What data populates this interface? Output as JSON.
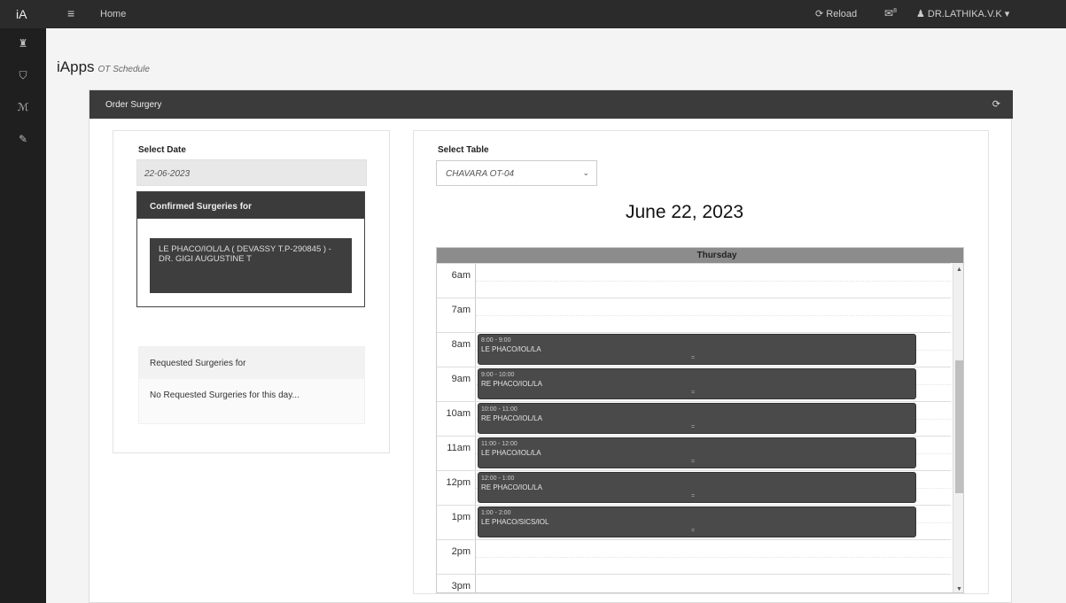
{
  "topbar": {
    "brand": "iA",
    "menu_icon": "≡",
    "home": "Home",
    "reload": "⟳ Reload",
    "mail_icon": "✉",
    "mail_badge": "8",
    "user": "♟ DR.LATHIKA.V.K ▾"
  },
  "sidebar": {
    "icons": [
      "♜",
      "⛉",
      "ℳ",
      "✎"
    ]
  },
  "app": {
    "title": "iApps",
    "subtitle": "OT Schedule"
  },
  "panel": {
    "title": "Order Surgery",
    "refresh_icon": "⟳"
  },
  "left": {
    "select_date_label": "Select Date",
    "date_value": "22-06-2023",
    "confirmed_title": "Confirmed Surgeries for",
    "confirmed_item": "LE PHACO/IOL/LA ( DEVASSY T.P-290845 ) - DR. GIGI AUGUSTINE T",
    "requested_title": "Requested Surgeries for",
    "requested_empty": "No Requested Surgeries for this day..."
  },
  "right": {
    "select_table_label": "Select Table",
    "table_value": "CHAVARA OT-04",
    "date_heading": "June 22, 2023",
    "day_header": "Thursday"
  },
  "calendar": {
    "hours": [
      "6am",
      "7am",
      "8am",
      "9am",
      "10am",
      "11am",
      "12pm",
      "1pm",
      "2pm",
      "3pm"
    ],
    "events": [
      {
        "time": "8:00 - 9:00",
        "title": "LE PHACO/IOL/LA"
      },
      {
        "time": "9:00 - 10:00",
        "title": "RE PHACO/IOL/LA"
      },
      {
        "time": "10:00 - 11:00",
        "title": "RE PHACO/IOL/LA"
      },
      {
        "time": "11:00 - 12:00",
        "title": "LE PHACO/IOL/LA"
      },
      {
        "time": "12:00 - 1:00",
        "title": "RE PHACO/IOL/LA"
      },
      {
        "time": "1:00 - 2:00",
        "title": "LE PHACO/SICS/IOL"
      }
    ]
  }
}
